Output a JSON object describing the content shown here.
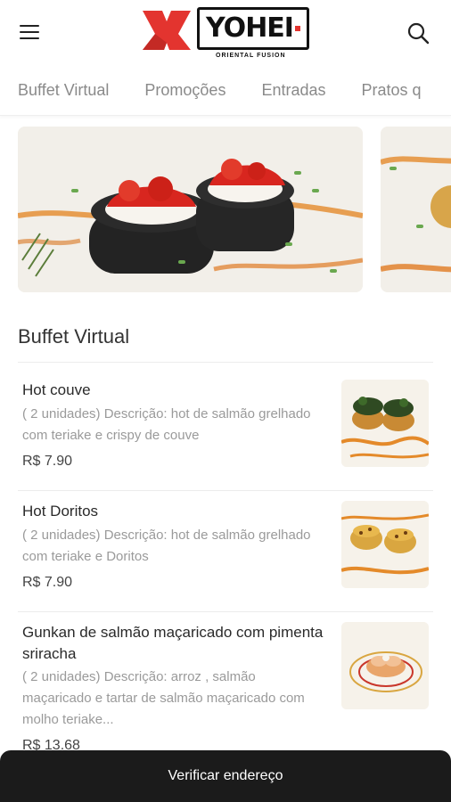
{
  "header": {
    "menu_icon": "hamburger-menu-icon",
    "logo_text": "YOHEI",
    "logo_tagline": "ORIENTAL FUSION",
    "search_icon": "search-icon",
    "brand_color": "#e3342f"
  },
  "tabs": [
    {
      "label": "Buffet Virtual"
    },
    {
      "label": "Promoções"
    },
    {
      "label": "Entradas"
    },
    {
      "label": "Pratos q"
    }
  ],
  "section": {
    "title": "Buffet Virtual"
  },
  "items": [
    {
      "name": "Hot couve",
      "description": "( 2 unidades) Descrição: hot de salmão grelhado com teriake e crispy de couve",
      "price": "R$ 7.90"
    },
    {
      "name": "Hot Doritos",
      "description": "( 2 unidades) Descrição: hot de salmão grelhado com teriake e Doritos",
      "price": "R$ 7.90"
    },
    {
      "name": "Gunkan de salmão maçaricado com pimenta sriracha",
      "description": "( 2 unidades) Descrição: arroz , salmão maçaricado e tartar de salmão maçaricado com molho teriake...",
      "price": "R$ 13.68"
    }
  ],
  "bottom_bar": {
    "label": "Verificar endereço"
  }
}
